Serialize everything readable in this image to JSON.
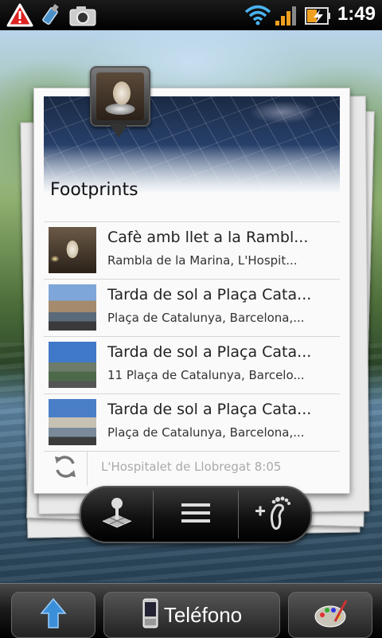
{
  "status_bar": {
    "time": "1:49",
    "icons": [
      "warning-icon",
      "usb-icon",
      "camera-icon",
      "wifi-icon",
      "signal-icon",
      "battery-charging-icon"
    ]
  },
  "widget": {
    "title": "Footprints",
    "items": [
      {
        "title": "Cafè amb llet a la Rambl...",
        "subtitle": "Rambla de la Marina, L'Hospit..."
      },
      {
        "title": "Tarda de sol a Plaça Cata...",
        "subtitle": "Plaça de Catalunya, Barcelona,..."
      },
      {
        "title": "Tarda de sol a Plaça Cata...",
        "subtitle": "11 Plaça de Catalunya, Barcelo..."
      },
      {
        "title": "Tarda de sol a Plaça Cata...",
        "subtitle": "Plaça de Catalunya, Barcelona,..."
      }
    ],
    "footer_status": "L'Hospitalet de Llobregat 8:05",
    "actions": [
      "add-location-icon",
      "list-menu-icon",
      "add-footprint-icon"
    ]
  },
  "dock": {
    "phone_label": "Teléfono",
    "left_icon": "up-arrow-icon",
    "right_icon": "palette-icon"
  },
  "colors": {
    "status_bar_bg": "#000000",
    "widget_bg": "#fafafa",
    "footer_text": "#aaaaaa"
  }
}
